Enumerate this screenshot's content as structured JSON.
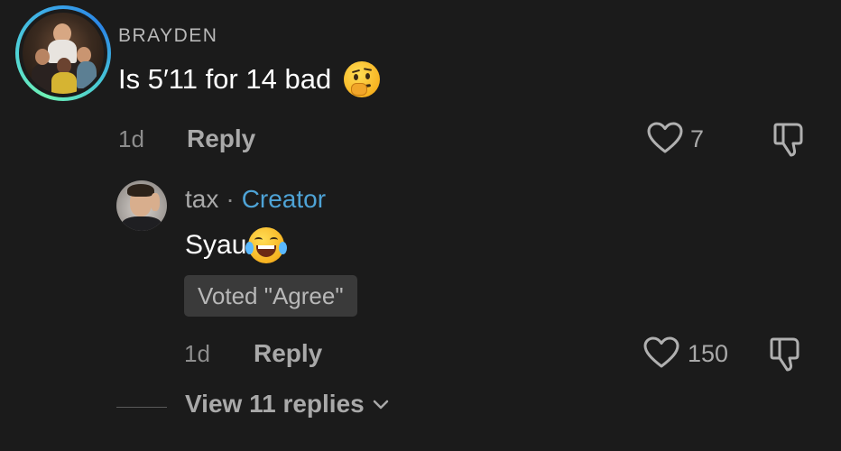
{
  "comment": {
    "username": "BRAYDEN",
    "text": "Is 5′11 for 14 bad",
    "emoji": "thinking-face",
    "time": "1d",
    "reply_label": "Reply",
    "likes": "7"
  },
  "reply": {
    "username": "tax",
    "separator": "·",
    "badge": "Creator",
    "text": "Syau",
    "emoji": "face-with-tears-of-joy",
    "vote": "Voted \"Agree\"",
    "time": "1d",
    "reply_label": "Reply",
    "likes": "150"
  },
  "view_replies": {
    "label": "View 11 replies"
  },
  "colors": {
    "background": "#1b1b1b",
    "creator": "#4ea3d6",
    "muted": "#a9a9a9"
  }
}
